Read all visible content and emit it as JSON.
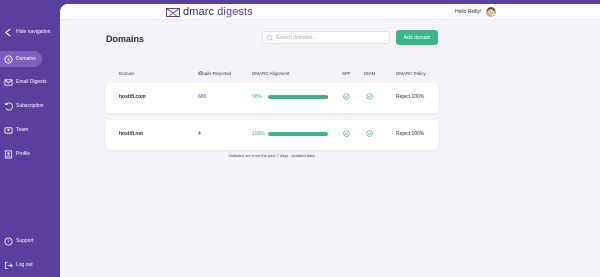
{
  "sidebar": {
    "hide_navigation": "Hide navigation",
    "items": [
      {
        "label": "Domains",
        "icon": "domains-icon",
        "active": true
      },
      {
        "label": "Email Digests",
        "icon": "email-icon",
        "active": false
      },
      {
        "label": "Subscription",
        "icon": "subscription-icon",
        "active": false
      },
      {
        "label": "Team",
        "icon": "team-icon",
        "active": false
      },
      {
        "label": "Profile",
        "icon": "profile-icon",
        "active": false
      }
    ],
    "support": "Support",
    "logout": "Log out"
  },
  "header": {
    "logo_prefix": "dmarc",
    "logo_suffix": "digests",
    "greeting": "Hello Reilly!"
  },
  "page": {
    "title": "Domains",
    "search_placeholder": "Search domains...",
    "add_button": "Add domain"
  },
  "table": {
    "columns": [
      "Domain",
      "Emails Reported",
      "DMARC Alignment",
      "SPF",
      "DKIM",
      "DMARC Policy"
    ],
    "rows": [
      {
        "domain": "hostifi.com",
        "emails_reported": "680",
        "alignment_text": "98%",
        "alignment_value": 98,
        "spf": "pass",
        "dkim": "pass",
        "policy": "Reject 100%"
      },
      {
        "domain": "hostifi.net",
        "emails_reported": "4",
        "alignment_text": "100%",
        "alignment_value": 100,
        "spf": "pass",
        "dkim": "pass",
        "policy": "Reject 100%"
      }
    ]
  },
  "footnote": "Statistics are from the past 7 days. Updated daily.",
  "colors": {
    "brand": "#5b3f9e",
    "accent_green": "#3ab58a",
    "fail_red": "#d94a4a",
    "background": "#f4f3fa"
  }
}
